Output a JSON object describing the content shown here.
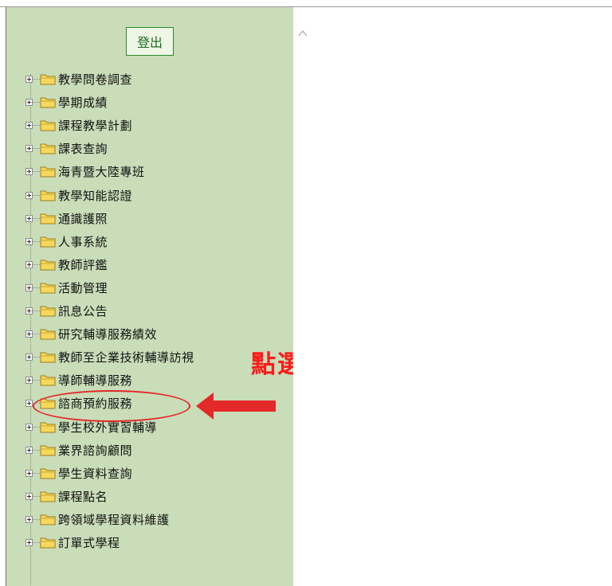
{
  "logout_label": "登出",
  "nav_items": [
    {
      "label": "教學問卷調查"
    },
    {
      "label": "學期成績"
    },
    {
      "label": "課程教學計劃"
    },
    {
      "label": "課表查詢"
    },
    {
      "label": "海青暨大陸專班"
    },
    {
      "label": "教學知能認證"
    },
    {
      "label": "通識護照"
    },
    {
      "label": "人事系統"
    },
    {
      "label": "教師評鑑"
    },
    {
      "label": "活動管理"
    },
    {
      "label": "訊息公告"
    },
    {
      "label": "研究輔導服務績效"
    },
    {
      "label": "教師至企業技術輔導訪視"
    },
    {
      "label": "導師輔導服務"
    },
    {
      "label": "諮商預約服務"
    },
    {
      "label": "學生校外實習輔導"
    },
    {
      "label": "業界諮詢顧問"
    },
    {
      "label": "學生資料查詢"
    },
    {
      "label": "課程點名"
    },
    {
      "label": "跨領域學程資料維護"
    },
    {
      "label": "訂單式學程"
    }
  ],
  "annotation": {
    "text": "點選",
    "highlighted_item": "導師輔導服務",
    "color": "#e32929"
  },
  "colors": {
    "sidebar_bg": "#c9ddb9",
    "folder_fill": "#f7d85c",
    "logout_border": "#2b8a2b"
  },
  "icons": {
    "expander": "plus-box-icon",
    "folder": "folder-icon",
    "scroll_up": "chevron-up-icon"
  }
}
